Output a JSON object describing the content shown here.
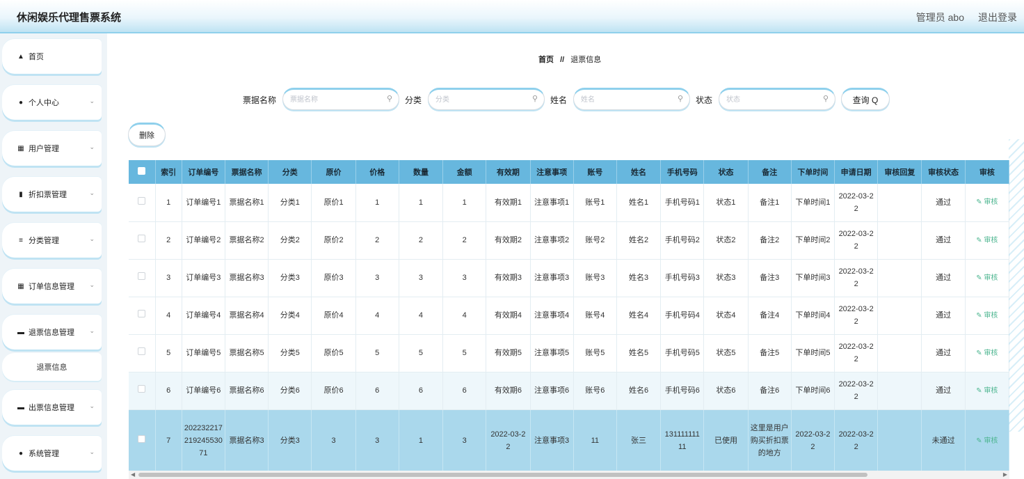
{
  "header": {
    "title": "休闲娱乐代理售票系统",
    "admin_label": "管理员 abo",
    "logout_label": "退出登录"
  },
  "sidebar": {
    "items": [
      {
        "label": "首页",
        "icon": "home-icon"
      },
      {
        "label": "个人中心",
        "icon": "user-icon"
      },
      {
        "label": "用户管理",
        "icon": "grid-icon"
      },
      {
        "label": "折扣票管理",
        "icon": "bar-icon"
      },
      {
        "label": "分类管理",
        "icon": "list-icon"
      },
      {
        "label": "订单信息管理",
        "icon": "grid-icon"
      },
      {
        "label": "退票信息管理",
        "icon": "monitor-icon"
      },
      {
        "label": "出票信息管理",
        "icon": "monitor-icon"
      },
      {
        "label": "系统管理",
        "icon": "user-icon"
      }
    ],
    "sub_item": "退票信息"
  },
  "breadcrumb": {
    "home": "首页",
    "separator": "//",
    "current": "退票信息"
  },
  "search": {
    "ticket_name_label": "票据名称",
    "ticket_name_placeholder": "票据名称",
    "category_label": "分类",
    "category_placeholder": "分类",
    "name_label": "姓名",
    "name_placeholder": "姓名",
    "status_label": "状态",
    "status_placeholder": "状态",
    "query_button": "查询 Q"
  },
  "delete_button": "删除",
  "table": {
    "headers": [
      "索引",
      "订单编号",
      "票据名称",
      "分类",
      "原价",
      "价格",
      "数量",
      "金额",
      "有效期",
      "注意事项",
      "账号",
      "姓名",
      "手机号码",
      "状态",
      "备注",
      "下单时间",
      "申请日期",
      "审核回复",
      "审核状态",
      "审核"
    ],
    "action_label": "审核",
    "rows": [
      [
        "1",
        "订单编号1",
        "票据名称1",
        "分类1",
        "原价1",
        "1",
        "1",
        "1",
        "有效期1",
        "注意事项1",
        "账号1",
        "姓名1",
        "手机号码1",
        "状态1",
        "备注1",
        "下单时间1",
        "2022-03-22",
        "",
        "通过"
      ],
      [
        "2",
        "订单编号2",
        "票据名称2",
        "分类2",
        "原价2",
        "2",
        "2",
        "2",
        "有效期2",
        "注意事项2",
        "账号2",
        "姓名2",
        "手机号码2",
        "状态2",
        "备注2",
        "下单时间2",
        "2022-03-22",
        "",
        "通过"
      ],
      [
        "3",
        "订单编号3",
        "票据名称3",
        "分类3",
        "原价3",
        "3",
        "3",
        "3",
        "有效期3",
        "注意事项3",
        "账号3",
        "姓名3",
        "手机号码3",
        "状态3",
        "备注3",
        "下单时间3",
        "2022-03-22",
        "",
        "通过"
      ],
      [
        "4",
        "订单编号4",
        "票据名称4",
        "分类4",
        "原价4",
        "4",
        "4",
        "4",
        "有效期4",
        "注意事项4",
        "账号4",
        "姓名4",
        "手机号码4",
        "状态4",
        "备注4",
        "下单时间4",
        "2022-03-22",
        "",
        "通过"
      ],
      [
        "5",
        "订单编号5",
        "票据名称5",
        "分类5",
        "原价5",
        "5",
        "5",
        "5",
        "有效期5",
        "注意事项5",
        "账号5",
        "姓名5",
        "手机号码5",
        "状态5",
        "备注5",
        "下单时间5",
        "2022-03-22",
        "",
        "通过"
      ],
      [
        "6",
        "订单编号6",
        "票据名称6",
        "分类6",
        "原价6",
        "6",
        "6",
        "6",
        "有效期6",
        "注意事项6",
        "账号6",
        "姓名6",
        "手机号码6",
        "状态6",
        "备注6",
        "下单时间6",
        "2022-03-22",
        "",
        "通过"
      ],
      [
        "7",
        "20223221721924553071",
        "票据名称3",
        "分类3",
        "3",
        "3",
        "1",
        "3",
        "2022-03-22",
        "注意事项3",
        "11",
        "张三",
        "13111111111",
        "已使用",
        "这里是用户购买折扣票的地方",
        "2022-03-22",
        "2022-03-22",
        "",
        "未通过"
      ]
    ]
  },
  "colors": {
    "accent": "#67b7de",
    "header_border": "#8fd0ec",
    "selected_row": "#aad8ec",
    "audit_link": "#4cb58f"
  }
}
